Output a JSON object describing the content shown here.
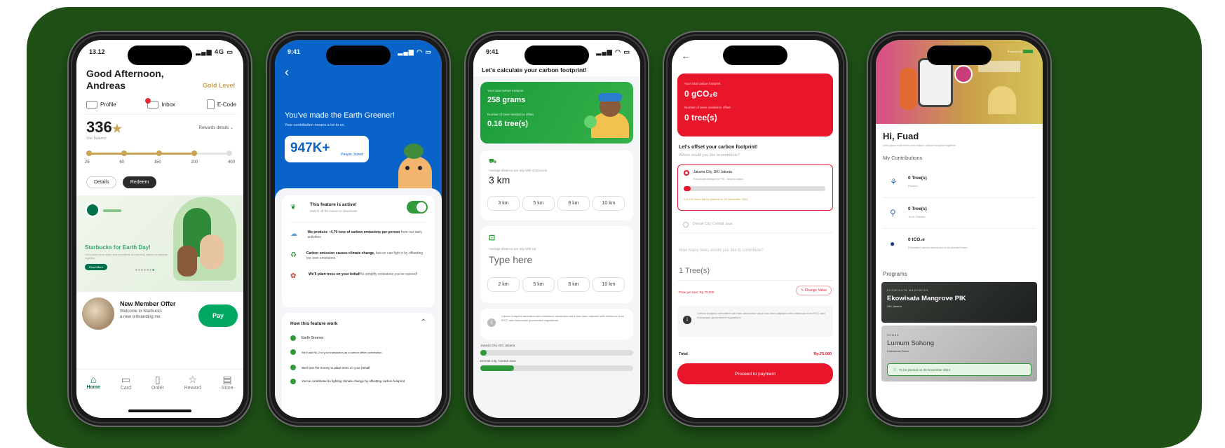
{
  "phone1": {
    "time": "13.12",
    "status_icons": "▂▄▆ 4G ▭",
    "greeting_line1": "Good Afternoon,",
    "greeting_line2": "Andreas",
    "level": "Gold Level",
    "nav": [
      "Profile",
      "Inbox",
      "E-Code"
    ],
    "stars": "336",
    "stars_caption": "Star Balance",
    "rewards_link": "Rewards details",
    "milestones": [
      "25",
      "60",
      "150",
      "200",
      "400"
    ],
    "details_btn": "Details",
    "redeem_btn": "Redeem",
    "promo_title": "Starbucks for Earth Day!",
    "promo_body": "Let's plant more trees and contribute to reducing carbon emissions together",
    "promo_cta": "Read More",
    "offer_title": "New Member Offer",
    "offer_body_1": "Welcome to Starbucks",
    "offer_body_2": "a new onboarding me",
    "pay": "Pay",
    "tabs": [
      "Home",
      "Card",
      "Order",
      "Reward",
      "Store"
    ]
  },
  "phone2": {
    "time": "9:41",
    "status_icons": "▂▄▆ ◠ ▭",
    "back": "‹",
    "headline": "You've made the Earth Greener!",
    "subline": "Your contribution means a lot to us.",
    "count": "947K+",
    "count_label": "People Joined",
    "feature_title": "This feature is active!",
    "feature_sub": "Switch off the button to deactivate",
    "facts": [
      {
        "bold": "We produce ~4,79 tons of carbon emissions per person",
        "rest": " from our daily activities"
      },
      {
        "bold": "Carbon emission causes climate change,",
        "rest": " but we can fight it by offsetting our own emissions"
      },
      {
        "bold": "We'll plant trees on your behalf",
        "rest": " to simplify emissions you've earned!"
      }
    ],
    "how_title": "How this feature work",
    "steps": [
      "Earth Greener",
      "We'll add Rp.2 to your transaction as a carbon offset contribution",
      "We'll use the money to plant trees on your behalf",
      "You've contributed to fighting climate change by offsetting carbon footprint"
    ]
  },
  "phone3": {
    "time": "9:41",
    "status_icons": "▂▄▆ ◠ ▭",
    "title": "Let's calculate your carbon footprint!",
    "total_label": "Your total carbon footprint",
    "total_value": "258 grams",
    "trees_label": "Number of trees needed to offset",
    "trees_value": "0.16 tree(s)",
    "motor_caption": "Average distance per day with motorcycle",
    "motor_value": "3 km",
    "motor_opts": [
      "3 km",
      "5 km",
      "8 km",
      "10 km"
    ],
    "car_caption": "Average distance per day with car",
    "car_placeholder": "Type here",
    "car_opts": [
      "2 km",
      "5 km",
      "8 km",
      "10 km"
    ],
    "info": "Carbon footprint calculation and emissions absorption value has been adjusted with reference from IPCC and Indonesian government regulations",
    "loc1": "Jakarta City, DKI Jakarta",
    "loc2": "Demak City, Central Java",
    "loc1_progress": 0.04,
    "loc2_progress": 0.22
  },
  "phone4": {
    "back": "←",
    "total_label": "Your total carbon footprint",
    "total_value": "0 gCO₂e",
    "trees_label": "Number of trees needed to offset",
    "trees_value": "0 tree(s)",
    "offset_title": "Let's offset your carbon footprint!",
    "where_q": "Where would you like to contribute?",
    "loc1": "Jakarta City, DKI Jakarta",
    "loc1_sub": "Ekowisata Mangrove PIK, Jakarta Utara",
    "loc1_progress": 0.05,
    "loc1_note": "0 of 100 trees will be planted on 20 November 2024",
    "loc2": "Demak City, Central Java",
    "how_many": "How many trees would you like to contribute?",
    "trees_input": "1 Tree(s)",
    "price_label": "Price per tree: Rp.75,000",
    "change_btn": "Change Value",
    "info": "Carbon footprint calculation and tree absorption value has been adjusted with reference from IPCC and Indonesian government regulations",
    "total_row": "Total",
    "total_amount": "Rp.75,000",
    "cta": "Proceed to payment"
  },
  "phone5": {
    "powered": "Powered by",
    "greeting": "Hi, Fuad",
    "subtitle": "Let's plant more trees and reduce carbon footprint together",
    "contrib_title": "My Contributions",
    "contrib": [
      {
        "value": "0 Tree(s)",
        "caption": "Planted"
      },
      {
        "value": "0 Tree(s)",
        "caption": "To be Planted"
      },
      {
        "value": "0 tCO₂e",
        "caption": "Estimated carbon absorption from planted trees"
      }
    ],
    "programs_title": "Programs",
    "programs": [
      {
        "tag": "EKOWISATA MANGROVE",
        "name": "Ekowisata Mangrove PIK",
        "place": "DKI Jakarta"
      },
      {
        "tag": "DEMAK",
        "name": "Lumum Sohong",
        "place": "Kalimantan Barat"
      }
    ],
    "planted_note": "To be planted on 20 November 2024"
  },
  "colors": {
    "bg_green": "#1f5117",
    "sb_green": "#00704a",
    "blue": "#0a63c9",
    "red": "#e8152b"
  }
}
